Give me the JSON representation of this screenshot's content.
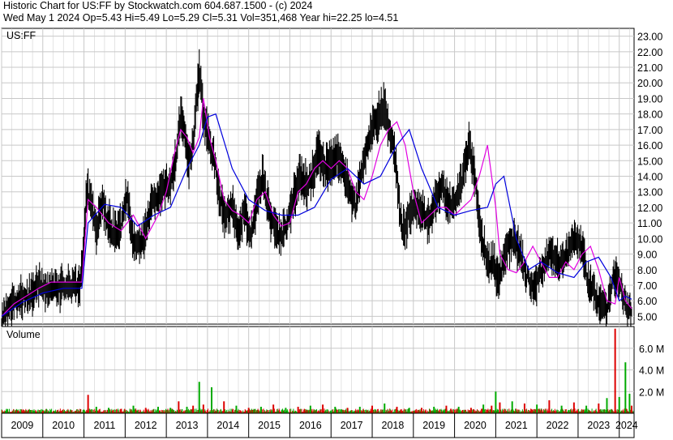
{
  "header": {
    "line1": "Historic Chart for US:FF by Stockwatch.com 604.687.1500 - (c) 2024",
    "line2": "Wed May  1 2024   Op=5.43  Hi=5.49  Lo=5.29  Cl=5.31  Vol=351,468  Year hi=22.25  lo=4.51"
  },
  "colors": {
    "background": "#ffffff",
    "grid": "#c8c8c8",
    "price_bars": "#000000",
    "ma_short": "#e000e0",
    "ma_long": "#0000dd",
    "volume_up": "#00aa00",
    "volume_down": "#dd0000"
  },
  "chart_data": [
    {
      "type": "line",
      "title": "US:FF",
      "ylim": [
        4.5,
        23.5
      ],
      "y_ticks": [
        5,
        6,
        7,
        8,
        9,
        10,
        11,
        12,
        13,
        14,
        15,
        16,
        17,
        18,
        19,
        20,
        21,
        22,
        23
      ],
      "y_tick_labels": [
        "5.00",
        "6.00",
        "7.00",
        "8.00",
        "9.00",
        "10.00",
        "11.00",
        "12.00",
        "13.00",
        "14.00",
        "15.00",
        "16.00",
        "17.00",
        "18.00",
        "19.00",
        "20.00",
        "21.00",
        "22.00",
        "23.00"
      ],
      "x_ticks": [
        2009,
        2010,
        2011,
        2012,
        2013,
        2014,
        2015,
        2016,
        2017,
        2018,
        2019,
        2020,
        2021,
        2022,
        2023,
        2024
      ],
      "x_tick_labels": [
        "2009",
        "2010",
        "2011",
        "2012",
        "2013",
        "2014",
        "2015",
        "2016",
        "2017",
        "2018",
        "2019",
        "2020",
        "2021",
        "2022",
        "2023",
        "2024"
      ],
      "xlim": [
        2009.0,
        2024.36
      ],
      "grid": true,
      "series": [
        {
          "style": "price_bars",
          "x": [
            2009.0,
            2009.15,
            2009.3,
            2009.45,
            2009.6,
            2009.75,
            2009.9,
            2010.1,
            2010.3,
            2010.5,
            2010.7,
            2010.9,
            2011.0,
            2011.05,
            2011.1,
            2011.2,
            2011.3,
            2011.45,
            2011.6,
            2011.75,
            2011.9,
            2012.05,
            2012.2,
            2012.35,
            2012.5,
            2012.65,
            2012.8,
            2012.95,
            2013.1,
            2013.25,
            2013.35,
            2013.45,
            2013.55,
            2013.65,
            2013.75,
            2013.8,
            2013.9,
            2014.0,
            2014.15,
            2014.3,
            2014.45,
            2014.6,
            2014.75,
            2014.9,
            2015.05,
            2015.2,
            2015.35,
            2015.5,
            2015.65,
            2015.8,
            2015.95,
            2016.1,
            2016.25,
            2016.4,
            2016.55,
            2016.7,
            2016.85,
            2017.0,
            2017.15,
            2017.3,
            2017.45,
            2017.6,
            2017.75,
            2017.9,
            2018.05,
            2018.2,
            2018.3,
            2018.4,
            2018.5,
            2018.6,
            2018.7,
            2018.8,
            2018.9,
            2019.0,
            2019.1,
            2019.25,
            2019.4,
            2019.55,
            2019.7,
            2019.85,
            2020.0,
            2020.1,
            2020.2,
            2020.35,
            2020.5,
            2020.65,
            2020.8,
            2020.95,
            2021.0,
            2021.05,
            2021.15,
            2021.3,
            2021.45,
            2021.6,
            2021.75,
            2021.9,
            2022.05,
            2022.2,
            2022.35,
            2022.5,
            2022.65,
            2022.8,
            2022.95,
            2023.1,
            2023.25,
            2023.4,
            2023.55,
            2023.7,
            2023.85,
            2024.0,
            2024.1,
            2024.2,
            2024.3
          ],
          "values": [
            4.8,
            5.3,
            6.0,
            6.3,
            6.1,
            6.5,
            7.1,
            6.7,
            6.8,
            6.9,
            6.9,
            6.9,
            9.5,
            12.8,
            13.0,
            11.8,
            10.5,
            12.2,
            11.0,
            10.2,
            10.8,
            12.5,
            9.8,
            9.4,
            10.5,
            12.5,
            12.8,
            13.3,
            13.5,
            15.5,
            17.8,
            16.5,
            15.0,
            16.0,
            19.5,
            21.0,
            18.0,
            16.5,
            15.3,
            12.5,
            11.5,
            12.0,
            10.5,
            12.0,
            10.0,
            12.5,
            14.0,
            11.5,
            10.5,
            10.3,
            11.0,
            12.8,
            14.0,
            13.5,
            14.2,
            15.5,
            14.5,
            14.8,
            15.5,
            14.5,
            13.0,
            12.0,
            14.5,
            16.0,
            17.5,
            18.0,
            18.5,
            17.0,
            16.0,
            14.0,
            11.0,
            10.5,
            11.5,
            12.0,
            12.0,
            11.5,
            11.0,
            12.5,
            13.5,
            12.0,
            12.5,
            12.8,
            14.0,
            16.0,
            14.0,
            10.0,
            8.5,
            8.5,
            7.5,
            7.5,
            8.0,
            9.5,
            10.0,
            9.0,
            7.5,
            7.0,
            7.5,
            8.5,
            9.0,
            8.5,
            8.5,
            9.5,
            10.0,
            9.5,
            7.0,
            6.5,
            5.5,
            5.5,
            7.5,
            7.5,
            6.0,
            5.5,
            5.3
          ],
          "name": ""
        },
        {
          "style": "ma_short",
          "x": [
            2009.0,
            2009.3,
            2009.6,
            2009.9,
            2010.2,
            2010.6,
            2010.95,
            2011.1,
            2011.3,
            2011.6,
            2011.9,
            2012.2,
            2012.5,
            2012.8,
            2013.0,
            2013.2,
            2013.35,
            2013.5,
            2013.65,
            2013.8,
            2013.9,
            2014.05,
            2014.2,
            2014.4,
            2014.6,
            2014.8,
            2015.0,
            2015.2,
            2015.4,
            2015.6,
            2015.8,
            2016.0,
            2016.2,
            2016.4,
            2016.6,
            2016.8,
            2017.0,
            2017.2,
            2017.4,
            2017.6,
            2017.8,
            2018.0,
            2018.2,
            2018.4,
            2018.6,
            2018.8,
            2019.0,
            2019.2,
            2019.4,
            2019.6,
            2019.8,
            2020.0,
            2020.2,
            2020.4,
            2020.6,
            2020.8,
            2021.0,
            2021.1,
            2021.3,
            2021.5,
            2021.7,
            2021.9,
            2022.1,
            2022.3,
            2022.5,
            2022.7,
            2022.9,
            2023.1,
            2023.3,
            2023.5,
            2023.7,
            2023.9,
            2024.0,
            2024.15,
            2024.3
          ],
          "values": [
            5.0,
            5.8,
            6.3,
            6.8,
            7.2,
            7.2,
            7.2,
            12.5,
            12.0,
            11.0,
            10.5,
            11.5,
            10.0,
            11.5,
            13.0,
            15.5,
            17.0,
            16.5,
            15.5,
            16.5,
            19.0,
            16.5,
            15.0,
            12.5,
            11.8,
            11.5,
            11.0,
            12.5,
            13.0,
            11.5,
            10.8,
            11.0,
            13.0,
            13.5,
            14.5,
            15.0,
            14.5,
            15.0,
            14.5,
            13.0,
            12.5,
            14.0,
            16.0,
            17.0,
            17.5,
            16.0,
            13.0,
            11.0,
            11.5,
            12.0,
            12.0,
            11.5,
            12.0,
            12.5,
            14.0,
            16.0,
            12.0,
            9.0,
            8.0,
            7.8,
            8.5,
            9.5,
            8.5,
            7.5,
            7.5,
            8.5,
            8.0,
            9.0,
            9.5,
            8.0,
            6.0,
            5.8,
            7.5,
            6.0,
            5.5
          ],
          "name": ""
        },
        {
          "style": "ma_long",
          "x": [
            2009.0,
            2009.5,
            2010.0,
            2010.5,
            2010.95,
            2011.1,
            2011.5,
            2011.9,
            2012.3,
            2012.7,
            2013.1,
            2013.5,
            2013.8,
            2014.0,
            2014.2,
            2014.6,
            2015.0,
            2015.4,
            2015.8,
            2016.2,
            2016.6,
            2017.0,
            2017.4,
            2017.8,
            2018.2,
            2018.6,
            2018.9,
            2019.2,
            2019.6,
            2020.0,
            2020.4,
            2020.8,
            2021.0,
            2021.2,
            2021.5,
            2021.8,
            2022.1,
            2022.5,
            2022.9,
            2023.2,
            2023.5,
            2023.8,
            2024.0,
            2024.15,
            2024.3
          ],
          "values": [
            5.0,
            5.9,
            6.5,
            6.8,
            6.8,
            11.0,
            12.2,
            12.0,
            10.8,
            11.5,
            12.0,
            14.5,
            16.0,
            17.8,
            18.0,
            14.5,
            12.5,
            11.8,
            11.5,
            11.5,
            12.0,
            13.8,
            14.5,
            13.5,
            14.0,
            16.0,
            17.0,
            14.5,
            12.0,
            11.5,
            11.8,
            12.0,
            13.5,
            14.0,
            10.0,
            8.0,
            8.5,
            7.8,
            7.5,
            8.5,
            8.8,
            7.5,
            6.0,
            6.3,
            6.1
          ],
          "name": ""
        }
      ]
    },
    {
      "type": "bar",
      "title": "Volume",
      "ylim": [
        0,
        8000000
      ],
      "y_ticks": [
        2000000,
        4000000,
        6000000
      ],
      "y_tick_labels": [
        "2.0 M",
        "4.0 M",
        "6.0 M"
      ],
      "x_ticks": [
        2009,
        2010,
        2011,
        2012,
        2013,
        2014,
        2015,
        2016,
        2017,
        2018,
        2019,
        2020,
        2021,
        2022,
        2023,
        2024
      ],
      "x_tick_labels": [
        "2009",
        "2010",
        "2011",
        "2012",
        "2013",
        "2014",
        "2015",
        "2016",
        "2017",
        "2018",
        "2019",
        "2020",
        "2021",
        "2022",
        "2023",
        "2024"
      ],
      "xlim": [
        2009.0,
        2024.36
      ],
      "grid": true,
      "series": [
        {
          "name": "",
          "style": "volume",
          "x": [
            2009.1,
            2009.4,
            2009.7,
            2010.0,
            2010.3,
            2010.6,
            2011.0,
            2011.1,
            2011.3,
            2011.6,
            2011.9,
            2012.2,
            2012.5,
            2012.8,
            2013.1,
            2013.3,
            2013.5,
            2013.65,
            2013.8,
            2013.9,
            2014.1,
            2014.4,
            2014.7,
            2015.0,
            2015.3,
            2015.6,
            2015.9,
            2016.2,
            2016.5,
            2016.8,
            2017.1,
            2017.4,
            2017.7,
            2018.0,
            2018.3,
            2018.6,
            2018.9,
            2019.2,
            2019.5,
            2019.8,
            2020.1,
            2020.4,
            2020.7,
            2020.9,
            2021.0,
            2021.1,
            2021.4,
            2021.7,
            2022.0,
            2022.3,
            2022.6,
            2022.9,
            2023.2,
            2023.5,
            2023.7,
            2023.9,
            2024.0,
            2024.15,
            2024.25,
            2024.3
          ],
          "values": [
            200000,
            250000,
            300000,
            200000,
            150000,
            150000,
            300000,
            1700000,
            600000,
            500000,
            400000,
            700000,
            500000,
            600000,
            500000,
            1100000,
            600000,
            700000,
            2900000,
            800000,
            2400000,
            1100000,
            700000,
            500000,
            600000,
            800000,
            500000,
            600000,
            700000,
            800000,
            600000,
            500000,
            600000,
            700000,
            900000,
            600000,
            500000,
            500000,
            600000,
            700000,
            600000,
            500000,
            800000,
            700000,
            2000000,
            1000000,
            1100000,
            900000,
            800000,
            1200000,
            700000,
            1000000,
            700000,
            900000,
            1400000,
            7800000,
            1500000,
            4700000,
            1800000,
            700000
          ],
          "up": [
            true,
            false,
            true,
            false,
            true,
            false,
            true,
            false,
            true,
            true,
            false,
            true,
            false,
            true,
            true,
            false,
            true,
            false,
            true,
            false,
            true,
            false,
            true,
            false,
            true,
            false,
            true,
            false,
            true,
            false,
            true,
            false,
            true,
            false,
            true,
            false,
            true,
            false,
            true,
            false,
            true,
            false,
            true,
            false,
            true,
            false,
            true,
            false,
            true,
            false,
            true,
            false,
            true,
            false,
            true,
            false,
            true,
            true,
            true,
            false
          ]
        }
      ]
    }
  ]
}
